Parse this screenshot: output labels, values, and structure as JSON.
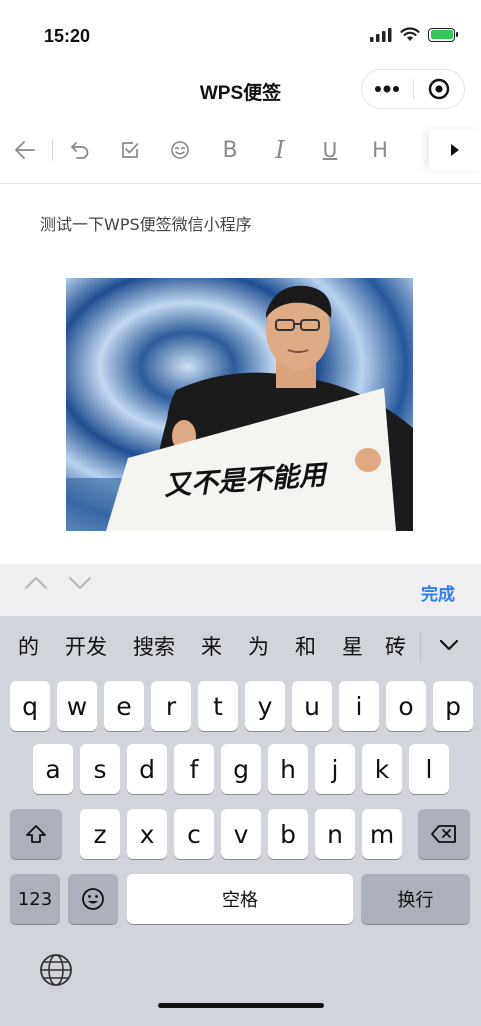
{
  "status_bar": {
    "time": "15:20"
  },
  "nav": {
    "title": "WPS便签"
  },
  "toolbar": {
    "icons": [
      "back-arrow-icon",
      "undo-icon",
      "checkbox-icon",
      "emoji-icon",
      "bold-icon",
      "italic-icon",
      "underline-icon",
      "heading-icon",
      "more-icon"
    ],
    "bold_label": "B",
    "italic_label": "I",
    "underline_label": "U",
    "heading_label": "H"
  },
  "document": {
    "text": "测试一下WPS便签微信小程序",
    "image_caption": "又不是不能用"
  },
  "accessory_bar": {
    "done_label": "完成"
  },
  "keyboard": {
    "candidates": [
      "的",
      "开发",
      "搜索",
      "来",
      "为",
      "和",
      "星",
      "砖"
    ],
    "row1": [
      "q",
      "w",
      "e",
      "r",
      "t",
      "y",
      "u",
      "i",
      "o",
      "p"
    ],
    "row2": [
      "a",
      "s",
      "d",
      "f",
      "g",
      "h",
      "j",
      "k",
      "l"
    ],
    "row3": [
      "z",
      "x",
      "c",
      "v",
      "b",
      "n",
      "m"
    ],
    "numbers_label": "123",
    "space_label": "空格",
    "return_label": "换行"
  },
  "colors": {
    "accent": "#2f7cf6",
    "battery": "#34c759",
    "keyboard_bg": "#d1d4da"
  }
}
